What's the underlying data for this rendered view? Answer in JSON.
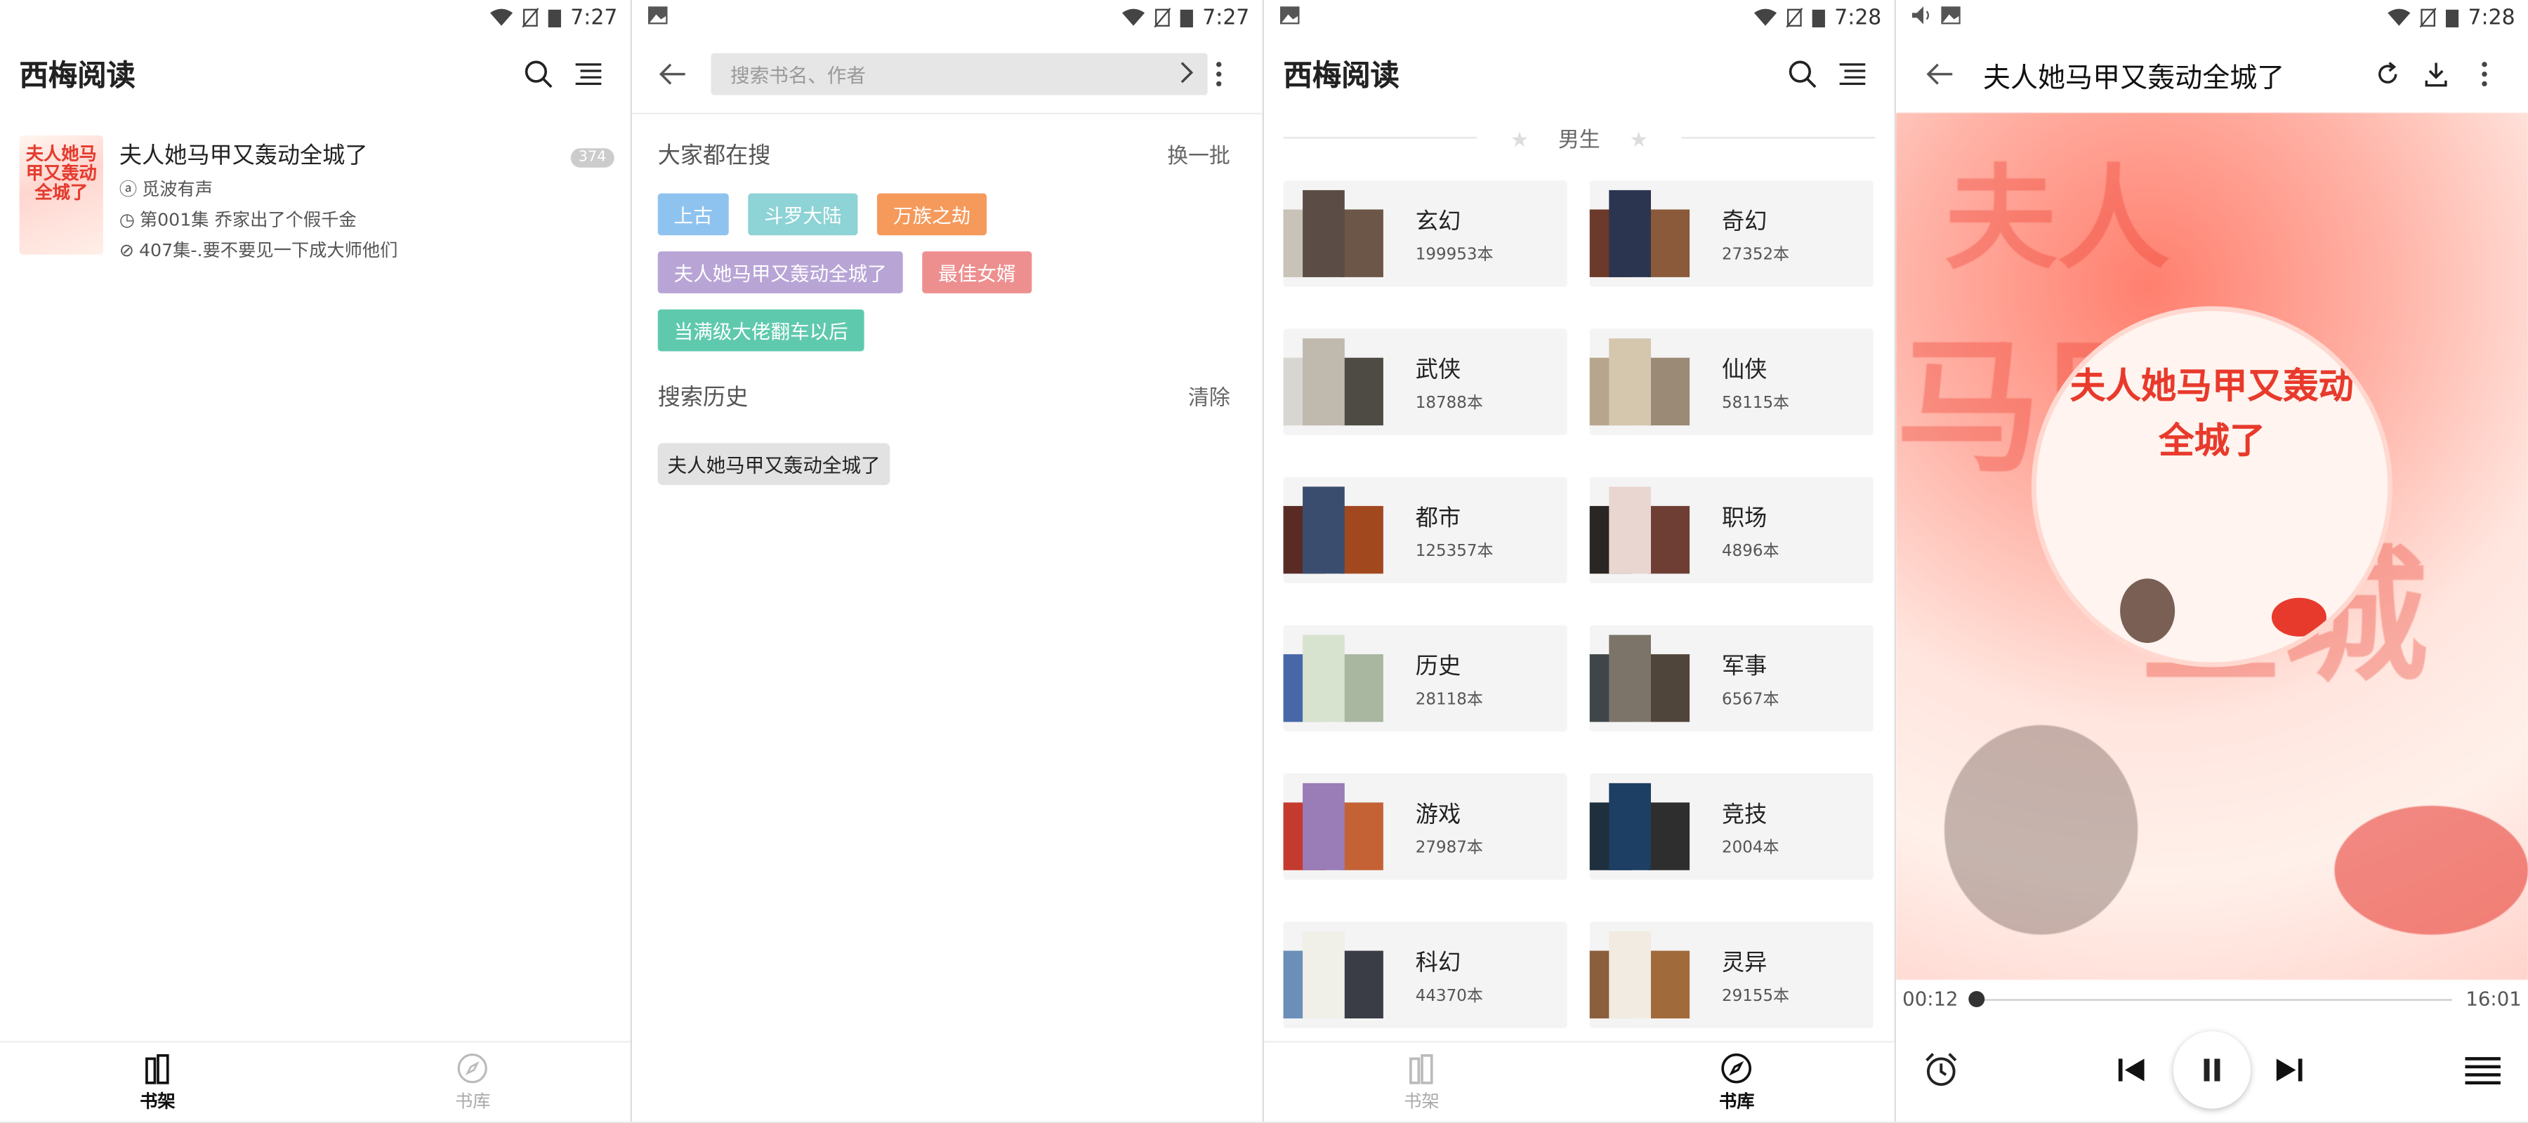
{
  "status": {
    "time1": "7:27",
    "time2": "7:27",
    "time3": "7:28",
    "time4": "7:28"
  },
  "shelf": {
    "title": "西梅阅读",
    "book": {
      "title": "夫人她马甲又轰动全城了",
      "cover_text": "夫人她马甲又轰动全城了",
      "author": "觅波有声",
      "chapter": "第001集 乔家出了个假千金",
      "latest": "407集-.要不要见一下成大师他们",
      "badge": "374"
    },
    "nav": {
      "shelf": "书架",
      "library": "书库"
    }
  },
  "search": {
    "placeholder": "搜索书名、作者",
    "hot_title": "大家都在搜",
    "refresh": "换一批",
    "hot_tags": [
      {
        "label": "上古",
        "color": "#8fc3ef"
      },
      {
        "label": "斗罗大陆",
        "color": "#8ed3d6"
      },
      {
        "label": "万族之劫",
        "color": "#f59a5b"
      },
      {
        "label": "夫人她马甲又轰动全城了",
        "color": "#b8a5d6"
      },
      {
        "label": "最佳女婿",
        "color": "#ee8f8f"
      },
      {
        "label": "当满级大佬翻车以后",
        "color": "#5fc9ae"
      }
    ],
    "history_title": "搜索历史",
    "clear": "清除",
    "history": [
      "夫人她马甲又轰动全城了"
    ]
  },
  "library": {
    "title": "西梅阅读",
    "gender": "男生",
    "categories": [
      {
        "name": "玄幻",
        "count": "199953本"
      },
      {
        "name": "奇幻",
        "count": "27352本"
      },
      {
        "name": "武侠",
        "count": "18788本"
      },
      {
        "name": "仙侠",
        "count": "58115本"
      },
      {
        "name": "都市",
        "count": "125357本"
      },
      {
        "name": "职场",
        "count": "4896本"
      },
      {
        "name": "历史",
        "count": "28118本"
      },
      {
        "name": "军事",
        "count": "6567本"
      },
      {
        "name": "游戏",
        "count": "27987本"
      },
      {
        "name": "竞技",
        "count": "2004本"
      },
      {
        "name": "科幻",
        "count": "44370本"
      },
      {
        "name": "灵异",
        "count": "29155本"
      }
    ],
    "nav": {
      "shelf": "书架",
      "library": "书库"
    }
  },
  "player": {
    "title": "夫人她马甲又轰动全城了",
    "cover_text": "夫人她马甲又轰动全城了",
    "current": "00:12",
    "total": "16:01",
    "progress": 0.012
  }
}
